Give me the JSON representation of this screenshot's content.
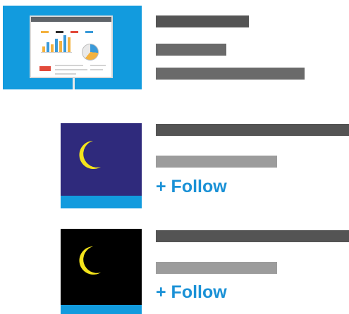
{
  "items": [
    {
      "type": "presentation",
      "thumbnail_icon": "presentation-board-icon"
    },
    {
      "type": "channel",
      "thumbnail_icon": "crescent-moon-icon",
      "thumbnail_background": "#2f2a7c",
      "follow_label": "+ Follow"
    },
    {
      "type": "channel",
      "thumbnail_icon": "crescent-moon-icon",
      "thumbnail_background": "#000000",
      "follow_label": "+ Follow"
    }
  ],
  "colors": {
    "accent": "#1a91d6",
    "thumbnail_strip": "#129bde",
    "moon": "#f3e31b",
    "placeholder_dark": "#545454",
    "placeholder_light": "#9c9c9c"
  }
}
